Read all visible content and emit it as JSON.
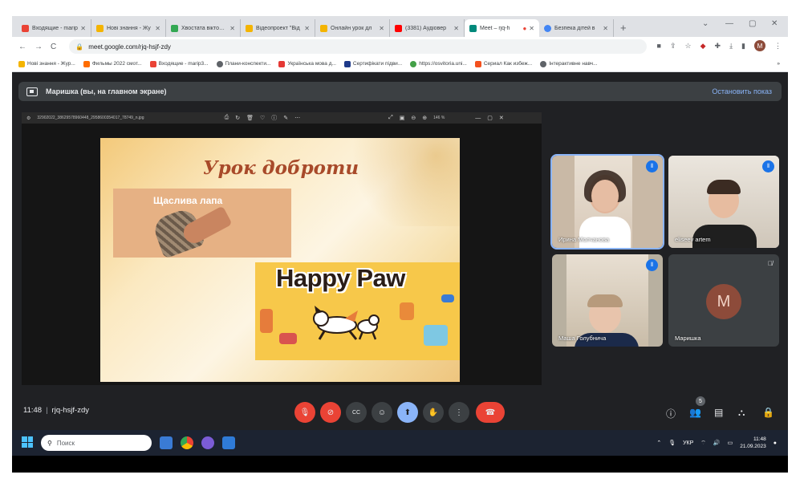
{
  "browser": {
    "tabs": [
      {
        "title": "Входящие - marip",
        "fav": "#ea4335"
      },
      {
        "title": "Нові знання - Жу",
        "fav": "#f4b400"
      },
      {
        "title": "Хвостата вікторин",
        "fav": "#34a853"
      },
      {
        "title": "Відеопроект \"Від",
        "fav": "#f4b400"
      },
      {
        "title": "Онлайн урок дл",
        "fav": "#f4b400"
      },
      {
        "title": "(3381) Аудіовер",
        "fav": "#ff0000"
      },
      {
        "title": "Meet – rjq-h",
        "fav": "#00897b",
        "active": true
      },
      {
        "title": "Безпека дітей в",
        "fav": "#4285f4"
      }
    ],
    "url": "meet.google.com/rjq-hsjf-zdy",
    "profile_initial": "M",
    "bookmarks": [
      {
        "label": "Нові знання - Жур...",
        "fav": "#f4b400"
      },
      {
        "label": "Фильмы 2022 смот...",
        "fav": "#ff6d00"
      },
      {
        "label": "Входящие - marip3...",
        "fav": "#ea4335"
      },
      {
        "label": "Плани-конспекти...",
        "fav": "#5f6368"
      },
      {
        "label": "Українська мова д...",
        "fav": "#e53935"
      },
      {
        "label": "Сертифікати підви...",
        "fav": "#1e3a8a"
      },
      {
        "label": "https://osvitoria.uni...",
        "fav": "#43a047"
      },
      {
        "label": "Сериал Как избеж...",
        "fav": "#f4511e"
      },
      {
        "label": "Інтерактивне навч...",
        "fav": "#5f6368"
      }
    ]
  },
  "meet": {
    "presenting_label": "Маришка (вы, на главном экране)",
    "stop_label": "Остановить показ",
    "viewer": {
      "filename": "32902022_38629578960448_2958600354017_78749_n.jpg",
      "zoom": "146 %"
    },
    "slide": {
      "title": "Урок доброти",
      "paw_label": "Щаслива лапа",
      "happy_paw": "Happy Paw"
    },
    "participants": [
      {
        "name": "Ирина Молчанова",
        "speaking": true
      },
      {
        "name": "eliseev artem"
      },
      {
        "name": "Маша Голубнича"
      },
      {
        "name": "Маришка",
        "initial": "M",
        "mic_off": true
      }
    ],
    "time": "11:48",
    "meeting_code": "rjq-hsjf-zdy",
    "people_count": "5"
  },
  "taskbar": {
    "search_placeholder": "Поиск",
    "lang": "УКР",
    "time": "11:48",
    "date": "21.09.2023"
  }
}
